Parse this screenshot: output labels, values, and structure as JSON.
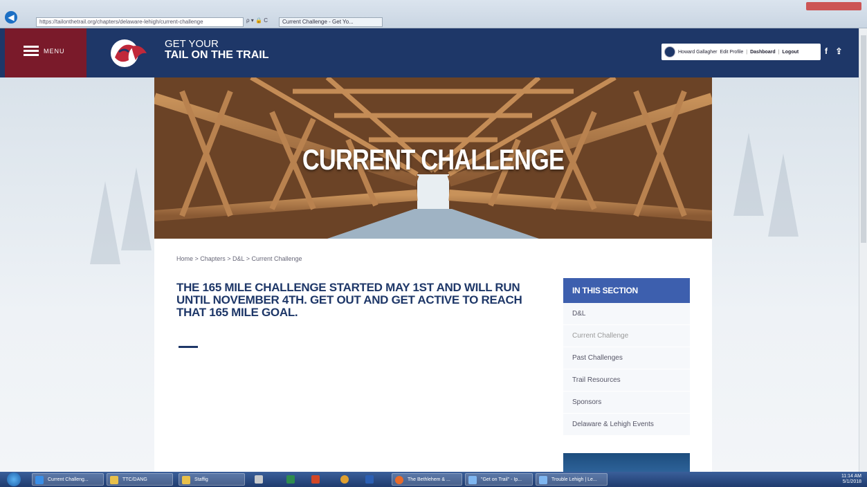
{
  "browser": {
    "url": "https://tailonthetrail.org/chapters/delaware-lehigh/current-challenge",
    "search_ctl": "ρ ▾ 🔒 C",
    "tab_title": "Current Challenge - Get Yo..."
  },
  "header": {
    "menu_label": "MENU",
    "brand_line1": "GET YOUR",
    "brand_line2": "TAIL ON THE TRAIL",
    "user_name": "Howard Gallagher",
    "edit_profile": "Edit Profile",
    "dashboard": "Dashboard",
    "logout": "Logout",
    "social_facebook": "f",
    "social_share": "⇪"
  },
  "hero": {
    "title": "CURRENT CHALLENGE"
  },
  "breadcrumb": "Home > Chapters > D&L > Current Challenge",
  "main": {
    "headline": "THE 165 MILE CHALLENGE STARTED MAY 1ST AND WILL RUN UNTIL NOVEMBER 4TH. GET OUT AND GET ACTIVE TO REACH THAT 165 MILE GOAL."
  },
  "sidebar": {
    "heading": "IN THIS SECTION",
    "items": [
      {
        "label": "D&L"
      },
      {
        "label": "Current Challenge"
      },
      {
        "label": "Past Challenges"
      },
      {
        "label": "Trail Resources"
      },
      {
        "label": "Sponsors"
      },
      {
        "label": "Delaware & Lehigh Events"
      }
    ]
  },
  "taskbar": {
    "items": [
      {
        "label": "Current Challeng..."
      },
      {
        "label": "TTC/DANG"
      },
      {
        "label": "Staffig"
      },
      {
        "label": ""
      },
      {
        "label": ""
      },
      {
        "label": ""
      },
      {
        "label": ""
      },
      {
        "label": ""
      },
      {
        "label": "The Bethlehem & ..."
      },
      {
        "label": "\"Get on Trail\" - Ip..."
      },
      {
        "label": "Trouble Lehigh | Le..."
      }
    ],
    "time": "11:14 AM",
    "date": "5/1/2018"
  },
  "colors": {
    "navy": "#1e3768",
    "maroon": "#7a1a2a",
    "section_blue": "#3d5fae"
  }
}
